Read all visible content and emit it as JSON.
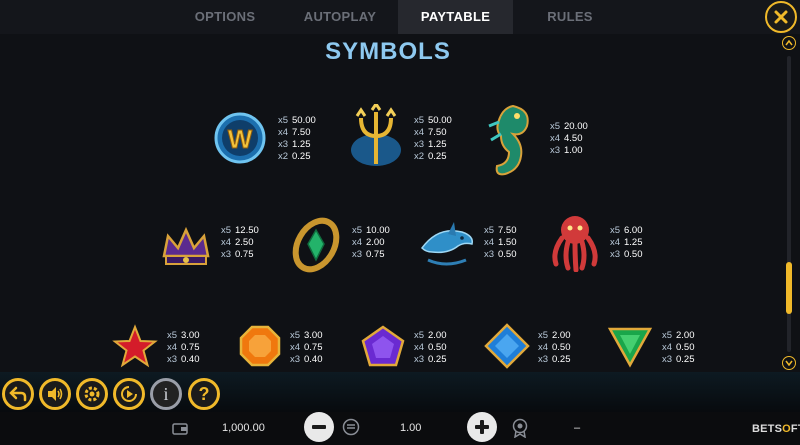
{
  "tabs": [
    {
      "label": "OPTIONS"
    },
    {
      "label": "AUTOPLAY"
    },
    {
      "label": "PAYTABLE"
    },
    {
      "label": "RULES"
    }
  ],
  "active_tab": "PAYTABLE",
  "title": "SYMBOLS",
  "symbols": [
    {
      "name": "wild-w",
      "icon": "wild-w-icon",
      "pays": [
        [
          "x5",
          "50.00"
        ],
        [
          "x4",
          "7.50"
        ],
        [
          "x3",
          "1.25"
        ],
        [
          "x2",
          "0.25"
        ]
      ]
    },
    {
      "name": "trident",
      "icon": "trident-icon",
      "pays": [
        [
          "x5",
          "50.00"
        ],
        [
          "x4",
          "7.50"
        ],
        [
          "x3",
          "1.25"
        ],
        [
          "x2",
          "0.25"
        ]
      ]
    },
    {
      "name": "seahorse",
      "icon": "seahorse-icon",
      "pays": [
        [
          "x5",
          "20.00"
        ],
        [
          "x4",
          "4.50"
        ],
        [
          "x3",
          "1.00"
        ]
      ]
    },
    {
      "name": "crown",
      "icon": "crown-icon",
      "pays": [
        [
          "x5",
          "12.50"
        ],
        [
          "x4",
          "2.50"
        ],
        [
          "x3",
          "0.75"
        ]
      ]
    },
    {
      "name": "bracelet",
      "icon": "bracelet-icon",
      "pays": [
        [
          "x5",
          "10.00"
        ],
        [
          "x4",
          "2.00"
        ],
        [
          "x3",
          "0.75"
        ]
      ]
    },
    {
      "name": "dolphin",
      "icon": "dolphin-icon",
      "pays": [
        [
          "x5",
          "7.50"
        ],
        [
          "x4",
          "1.50"
        ],
        [
          "x3",
          "0.50"
        ]
      ]
    },
    {
      "name": "octopus",
      "icon": "octopus-icon",
      "pays": [
        [
          "x5",
          "6.00"
        ],
        [
          "x4",
          "1.25"
        ],
        [
          "x3",
          "0.50"
        ]
      ]
    },
    {
      "name": "red-star",
      "icon": "star-gem-icon",
      "pays": [
        [
          "x5",
          "3.00"
        ],
        [
          "x4",
          "0.75"
        ],
        [
          "x3",
          "0.40"
        ]
      ]
    },
    {
      "name": "orange-octagon",
      "icon": "octagon-gem-icon",
      "pays": [
        [
          "x5",
          "3.00"
        ],
        [
          "x4",
          "0.75"
        ],
        [
          "x3",
          "0.40"
        ]
      ]
    },
    {
      "name": "purple-pentagon",
      "icon": "pentagon-gem-icon",
      "pays": [
        [
          "x5",
          "2.00"
        ],
        [
          "x4",
          "0.50"
        ],
        [
          "x3",
          "0.25"
        ]
      ]
    },
    {
      "name": "blue-diamond",
      "icon": "diamond-gem-icon",
      "pays": [
        [
          "x5",
          "2.00"
        ],
        [
          "x4",
          "0.50"
        ],
        [
          "x3",
          "0.25"
        ]
      ]
    },
    {
      "name": "green-triangle",
      "icon": "triangle-gem-icon",
      "pays": [
        [
          "x5",
          "2.00"
        ],
        [
          "x4",
          "0.50"
        ],
        [
          "x3",
          "0.25"
        ]
      ]
    }
  ],
  "bottom": {
    "balance": "1,000.00",
    "bet": "1.00",
    "win": "–",
    "info_label": "i",
    "help_label": "?",
    "logo_main": "BETS",
    "logo_o": "O",
    "logo_tail": "FT"
  },
  "colors": {
    "accent": "#f0b92a",
    "title": "#8ec9f0",
    "background": "#0f1115"
  }
}
